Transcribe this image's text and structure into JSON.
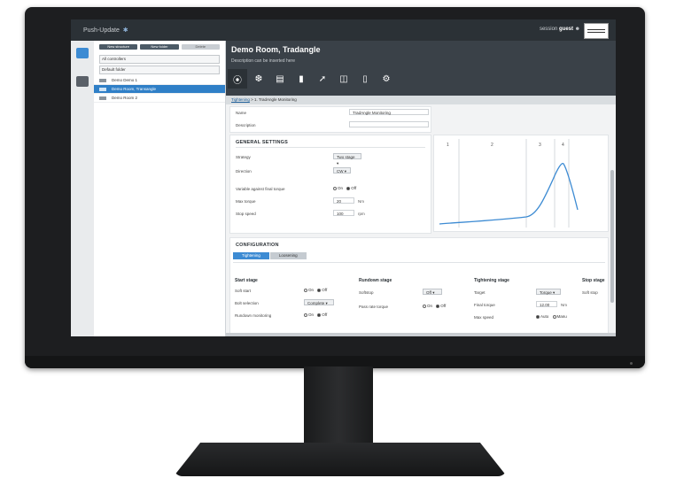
{
  "app": {
    "name": "Push-Update",
    "user_label": "session",
    "user_name": "guest"
  },
  "tree": {
    "buttons": [
      "New structure",
      "New folder",
      "Delete"
    ],
    "filter": "All controllers",
    "group": "Default folder",
    "items": [
      {
        "label": "Demo Demo 1",
        "selected": false
      },
      {
        "label": "Demo Room, Transangle",
        "selected": true
      },
      {
        "label": "Demo Room 2",
        "selected": false
      }
    ]
  },
  "program": {
    "title": "Demo Room, Tradangle",
    "description": "Description can be inserted here",
    "breadcrumb_link": "Tightening",
    "breadcrumb_rest": " > 1. TradAngle Monitoring"
  },
  "toolbar": [
    "tightening-icon",
    "settings-cog-icon",
    "controller-icon",
    "device-icon",
    "wrench-icon",
    "batch-icon",
    "tool-icon",
    "gear-icon"
  ],
  "form": {
    "name_label": "Name",
    "name_value": "TradAngle Monitoring",
    "description_label": "Description",
    "general_title": "GENERAL SETTINGS",
    "strategy_label": "Strategy",
    "strategy_value": "Two stage",
    "direction_label": "Direction",
    "direction_value": "CW",
    "variable_label": "Variable against final torque",
    "on_label": "On",
    "off_label": "Off",
    "max_torque_label": "Max torque",
    "max_torque_value": "20",
    "max_torque_unit": "Nm",
    "stop_speed_label": "Stop speed",
    "stop_speed_value": "100",
    "stop_speed_unit": "rpm"
  },
  "graph": {
    "stage_labels": [
      "1",
      "2",
      "3",
      "4"
    ],
    "curve_color": "#3d8bd3"
  },
  "config": {
    "title": "CONFIGURATION",
    "tabs": [
      {
        "label": "Tightening",
        "active": true
      },
      {
        "label": "Loosening",
        "active": false
      }
    ],
    "start": {
      "title": "Start stage",
      "soft_start_label": "Soft start",
      "bolt_label": "Bolt selection",
      "bolt_value": "Complete",
      "thread_label": "Rundown monitoring"
    },
    "rundown": {
      "title": "Rundown stage",
      "softstop_label": "Softstop",
      "softstop_value": "Off",
      "torque_label": "Pass rate torque"
    },
    "tighten": {
      "title": "Tightening stage",
      "target_label": "Target",
      "target_value": "Torque",
      "final_label": "Final torque",
      "final_value": "12.00",
      "final_unit": "Nm",
      "speed_label": "Max speed",
      "auto_label": "Auto",
      "manu_label": "Manu"
    },
    "stop": {
      "title": "Stop stage",
      "label": "Soft stop"
    }
  }
}
